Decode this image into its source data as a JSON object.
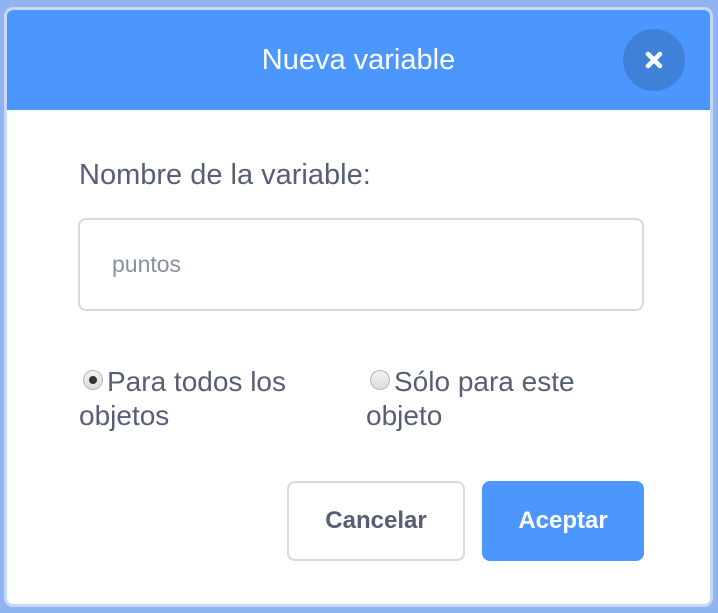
{
  "dialog": {
    "title": "Nueva variable",
    "close_icon": "close-icon",
    "name_label": "Nombre de la variable:",
    "name_input": {
      "value": "",
      "placeholder": "puntos"
    },
    "scope_options": [
      {
        "label": "Para todos los objetos",
        "selected": true
      },
      {
        "label": "Sólo para este objeto",
        "selected": false
      }
    ],
    "cancel_label": "Cancelar",
    "accept_label": "Aceptar"
  },
  "colors": {
    "header": "#4c97ff",
    "close_button": "#3f80d9",
    "accept_button": "#4c97ff",
    "text": "#575e75"
  }
}
